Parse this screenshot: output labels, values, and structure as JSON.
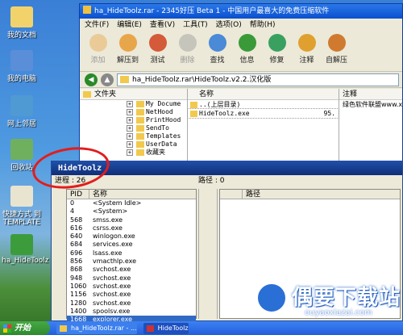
{
  "desktop_icons": [
    {
      "label": "我的文档",
      "color": "#f2d36b"
    },
    {
      "label": "我的电脑",
      "color": "#5b8ed8"
    },
    {
      "label": "网上邻居",
      "color": "#4f9ad3"
    },
    {
      "label": "回收站",
      "color": "#6fb05f"
    },
    {
      "label": "快捷方式 到 TEMPLATE",
      "color": "#e9e4d0"
    },
    {
      "label": "ha_HideToolz",
      "color": "#3c9c3c"
    }
  ],
  "archiver": {
    "title": "ha_HideToolz.rar - 2345好压 Beta 1 - 中国用户最喜大的免费压缩软件",
    "menu": [
      "文件(F)",
      "编辑(E)",
      "查看(V)",
      "工具(T)",
      "选项(O)",
      "帮助(H)"
    ],
    "toolbar": [
      {
        "label": "添加",
        "color": "#e8a64a",
        "disabled": true
      },
      {
        "label": "解压到",
        "color": "#e8a64a",
        "disabled": false
      },
      {
        "label": "测试",
        "color": "#d45a3a",
        "disabled": false
      },
      {
        "label": "删除",
        "color": "#9a9a9a",
        "disabled": true
      },
      {
        "label": "查找",
        "color": "#4a8ad6",
        "disabled": false
      },
      {
        "label": "信息",
        "color": "#3a9a3a",
        "disabled": false
      },
      {
        "label": "修复",
        "color": "#3aa060",
        "disabled": false
      },
      {
        "label": "注释",
        "color": "#e0a030",
        "disabled": false
      },
      {
        "label": "自解压",
        "color": "#d07a30",
        "disabled": false
      }
    ],
    "address": "ha_HideToolz.rar\\HideToolz.v2.2.汉化版",
    "tree_header": "文件夹",
    "tree_items": [
      "My Docume",
      "NetHood",
      "PrintHood",
      "SendTo",
      "Templates",
      "UserData",
      "收藏夹"
    ],
    "files_header": "名称",
    "files": [
      {
        "name": "..(上层目录)",
        "size": ""
      },
      {
        "name": "HideToolz.exe",
        "size": "95."
      }
    ],
    "notes_header": "注释",
    "notes_value": "绿色软件联盟www.xd"
  },
  "hidetoolz": {
    "title": "HideToolz",
    "process_label": "进程 : 26",
    "path_label": "路径 : 0",
    "columns": {
      "pid": "PID",
      "name": "名称",
      "path": "路径"
    },
    "processes": [
      {
        "pid": "0",
        "name": "<System Idle>"
      },
      {
        "pid": "4",
        "name": "<System>"
      },
      {
        "pid": "568",
        "name": "smss.exe"
      },
      {
        "pid": "616",
        "name": "csrss.exe"
      },
      {
        "pid": "640",
        "name": "winlogon.exe"
      },
      {
        "pid": "684",
        "name": "services.exe"
      },
      {
        "pid": "696",
        "name": "lsass.exe"
      },
      {
        "pid": "856",
        "name": "vmacthlp.exe"
      },
      {
        "pid": "868",
        "name": "svchost.exe"
      },
      {
        "pid": "948",
        "name": "svchost.exe"
      },
      {
        "pid": "1060",
        "name": "svchost.exe"
      },
      {
        "pid": "1156",
        "name": "svchost.exe"
      },
      {
        "pid": "1280",
        "name": "svchost.exe"
      },
      {
        "pid": "1400",
        "name": "spoolsv.exe"
      },
      {
        "pid": "1668",
        "name": "explorer.exe"
      }
    ]
  },
  "watermark": {
    "text": "偶要下载站",
    "url": "ouyaoxiazai.com"
  },
  "taskbar": {
    "start": "开始",
    "tasks": [
      "ha_HideToolz.rar - ...",
      "HideToolz"
    ]
  }
}
